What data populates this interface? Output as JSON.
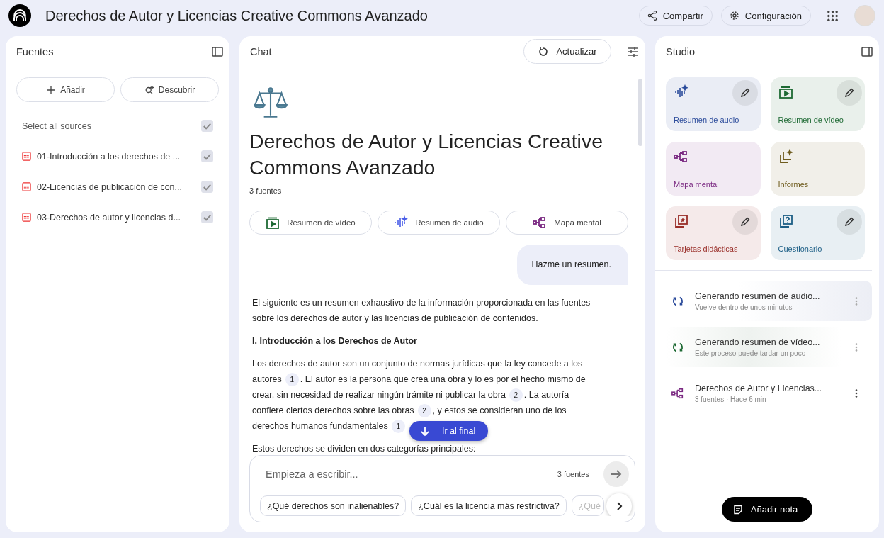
{
  "app_bar": {
    "title": "Derechos de Autor y Licencias Creative Commons Avanzado",
    "buttons": [
      {
        "kind": "share",
        "label": "Compartir"
      },
      {
        "kind": "settings",
        "label": "Configuración"
      }
    ]
  },
  "sources": {
    "title": "Fuentes",
    "actions": [
      {
        "kind": "add",
        "label": "Añadir"
      },
      {
        "kind": "discover",
        "label": "Descubrir"
      }
    ],
    "select_all": {
      "label": "Select all sources",
      "checked": true
    },
    "items": [
      {
        "name": "01-Introducción a los derechos de ...",
        "checked": true
      },
      {
        "name": "02-Licencias de publicación de con...",
        "checked": true
      },
      {
        "name": "03-Derechos de autor y licencias d...",
        "checked": true
      }
    ]
  },
  "chat": {
    "title": "Chat",
    "refresh_label": "Actualizar",
    "notebook_title": "Derechos de Autor y Licencias Creative Commons Avanzado",
    "source_count": "3 fuentes",
    "quick_actions": [
      {
        "kind": "video",
        "label": "Resumen de vídeo"
      },
      {
        "kind": "audio",
        "label": "Resumen de audio"
      },
      {
        "kind": "mindmap",
        "label": "Mapa mental"
      }
    ],
    "user_message": "Hazme un resumen.",
    "response": [
      {
        "kind": "text",
        "parts": [
          {
            "text": "El siguiente es un resumen exhaustivo de la información proporcionada en las fuentes sobre los derechos de autor y las licencias de publicación de contenidos."
          }
        ]
      },
      {
        "kind": "heading",
        "parts": [
          {
            "text": "I. Introducción a los Derechos de Autor"
          }
        ]
      },
      {
        "kind": "text",
        "parts": [
          {
            "text": "Los derechos de autor son un conjunto de normas jurídicas que la ley concede a los autores",
            "cite": "1"
          },
          {
            "text": ". El autor es la persona que crea una obra y lo es por el hecho mismo de crear, sin necesidad de realizar ningún trámite ni publicar la obra",
            "cite": "2"
          },
          {
            "text": ". La autoría confiere ciertos derechos sobre las obras",
            "cite": "2"
          },
          {
            "text": ", y estos se consideran uno de los derechos humanos fundamentales",
            "cite": "1"
          }
        ]
      },
      {
        "kind": "text",
        "parts": [
          {
            "text": "Estos derechos se dividen en dos categorías principales:"
          }
        ]
      }
    ],
    "jump_label": "Ir al final",
    "input": {
      "placeholder": "Empieza a escribir...",
      "source_count": "3 fuentes"
    },
    "suggestions": [
      "¿Qué derechos son inalienables?",
      "¿Cuál es la licencia más restrictiva?",
      "¿Qué"
    ]
  },
  "studio": {
    "title": "Studio",
    "tiles": [
      {
        "kind": "audio",
        "label": "Resumen de audio",
        "color": "#2b4b9b",
        "editable": true
      },
      {
        "kind": "video",
        "label": "Resumen de vídeo",
        "color": "#1e6a34",
        "editable": true
      },
      {
        "kind": "mindmap",
        "label": "Mapa mental",
        "color": "#7b2a82",
        "editable": false
      },
      {
        "kind": "report",
        "label": "Informes",
        "color": "#6f5c1e",
        "editable": false
      },
      {
        "kind": "flashcards",
        "label": "Tarjetas didácticas",
        "color": "#9a2f2a",
        "editable": true
      },
      {
        "kind": "quiz",
        "label": "Cuestionario",
        "color": "#1d5f86",
        "editable": true
      }
    ],
    "outputs": [
      {
        "kind": "audio",
        "title": "Generando resumen de audio...",
        "subtitle": "Vuelve dentro de unos minutos",
        "generating": true
      },
      {
        "kind": "video",
        "title": "Generando resumen de vídeo...",
        "subtitle": "Este proceso puede tardar un poco",
        "generating": true
      },
      {
        "kind": "mindmap",
        "title": "Derechos de Autor y Licencias...",
        "subtitle": "3 fuentes · Hace 6 min",
        "generating": false
      }
    ],
    "note_button": "Añadir nota"
  }
}
